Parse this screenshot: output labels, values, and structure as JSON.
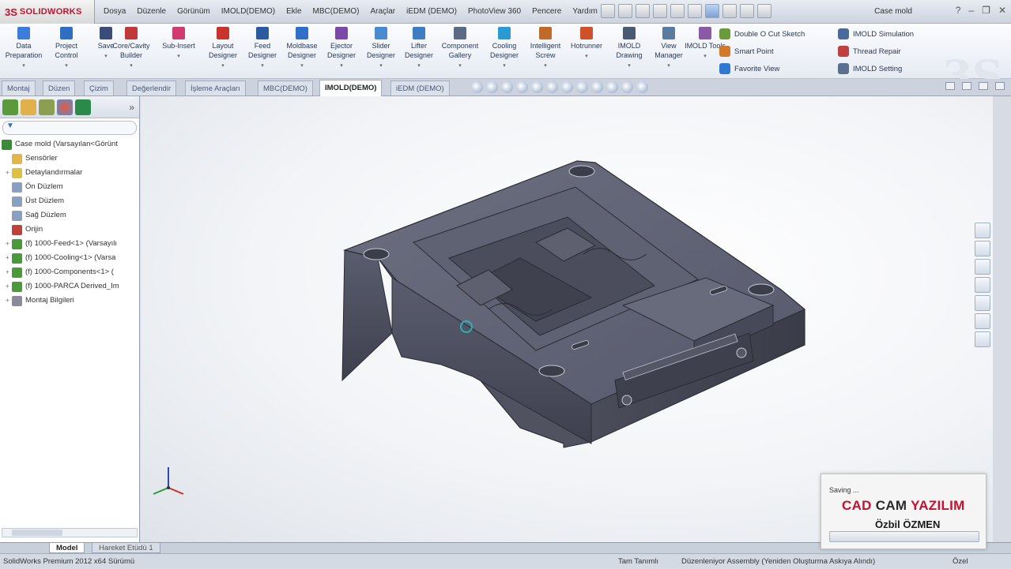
{
  "app": {
    "brand_mark": "3S",
    "brand_name": "SOLIDWORKS",
    "doc_title": "Case mold"
  },
  "menu": [
    "Dosya",
    "Düzenle",
    "Görünüm",
    "IMOLD(DEMO)",
    "Ekle",
    "MBC(DEMO)",
    "Araçlar",
    "iEDM (DEMO)",
    "PhotoView 360",
    "Pencere",
    "Yardım"
  ],
  "ribbon": {
    "buttons": [
      {
        "label": "Data Preparation",
        "icon": "data-preparation-icon",
        "color": "#3b7dd8"
      },
      {
        "label": "Project Control",
        "icon": "project-control-icon",
        "color": "#2f6fc2"
      },
      {
        "label": "Save",
        "icon": "save-icon",
        "color": "#3a4c7a"
      },
      {
        "label": "Core/Cavity Builder",
        "icon": "core-cavity-icon",
        "color": "#c03a3a"
      },
      {
        "label": "Sub-Insert",
        "icon": "sub-insert-icon",
        "color": "#d03a6e"
      },
      {
        "label": "Layout Designer",
        "icon": "layout-designer-icon",
        "color": "#c8342b"
      },
      {
        "label": "Feed Designer",
        "icon": "feed-designer-icon",
        "color": "#2c5aa0"
      },
      {
        "label": "Moldbase Designer",
        "icon": "moldbase-designer-icon",
        "color": "#2f6ec9"
      },
      {
        "label": "Ejector Designer",
        "icon": "ejector-designer-icon",
        "color": "#7a4aa8"
      },
      {
        "label": "Slider Designer",
        "icon": "slider-designer-icon",
        "color": "#4a8ad0"
      },
      {
        "label": "Lifter Designer",
        "icon": "lifter-designer-icon",
        "color": "#3e7cc4"
      },
      {
        "label": "Component Gallery",
        "icon": "component-gallery-icon",
        "color": "#5a6c84"
      },
      {
        "label": "Cooling Designer",
        "icon": "cooling-designer-icon",
        "color": "#2a9ad4"
      },
      {
        "label": "Intelligent Screw",
        "icon": "intelligent-screw-icon",
        "color": "#c06a2a"
      },
      {
        "label": "Hotrunner",
        "icon": "hotrunner-icon",
        "color": "#d0502a"
      },
      {
        "label": "IMOLD Drawing",
        "icon": "imold-drawing-icon",
        "color": "#4a5a70"
      },
      {
        "label": "View Manager",
        "icon": "view-manager-icon",
        "color": "#5a7aa0"
      },
      {
        "label": "IMOLD Tools",
        "icon": "imold-tools-icon",
        "color": "#8a5aa8"
      }
    ],
    "side1": [
      {
        "label": "Double O Cut Sketch",
        "icon": "double-o-cut-sketch-icon",
        "color": "#6a9a3a"
      },
      {
        "label": "Smart Point",
        "icon": "smart-point-icon",
        "color": "#d07a2a"
      },
      {
        "label": "Favorite View",
        "icon": "favorite-view-icon",
        "color": "#2f7ad0"
      }
    ],
    "side2": [
      {
        "label": "IMOLD Simulation",
        "icon": "imold-simulation-icon",
        "color": "#4a6a9a"
      },
      {
        "label": "Thread Repair",
        "icon": "thread-repair-icon",
        "color": "#c04040"
      },
      {
        "label": "IMOLD Setting",
        "icon": "imold-setting-icon",
        "color": "#5a7090"
      }
    ]
  },
  "tabs": [
    "Montaj",
    "Düzen",
    "Çizim",
    "Değerlendir",
    "İşleme Araçları",
    "MBC(DEMO)",
    "IMOLD(DEMO)",
    "iEDM (DEMO)"
  ],
  "active_tab": "IMOLD(DEMO)",
  "tree": [
    {
      "label": "Case mold  (Varsayılan<Görünt",
      "icon": "assembly-icon",
      "color": "#3a8a3a",
      "expand": ""
    },
    {
      "label": "Sensörler",
      "icon": "sensors-folder-icon",
      "color": "#e2b64a",
      "expand": ""
    },
    {
      "label": "Detaylandırmalar",
      "icon": "annotations-icon",
      "color": "#e0c040",
      "expand": "+"
    },
    {
      "label": "Ön Düzlem",
      "icon": "plane-icon",
      "color": "#8aa0c0",
      "expand": ""
    },
    {
      "label": "Üst Düzlem",
      "icon": "plane-icon",
      "color": "#8aa0c0",
      "expand": ""
    },
    {
      "label": "Sağ Düzlem",
      "icon": "plane-icon",
      "color": "#8aa0c0",
      "expand": ""
    },
    {
      "label": "Orijin",
      "icon": "origin-icon",
      "color": "#c0403a",
      "expand": ""
    },
    {
      "label": "(f) 1000-Feed<1> (Varsayılı",
      "icon": "part-icon",
      "color": "#4a9a3a",
      "expand": "+"
    },
    {
      "label": "(f) 1000-Cooling<1> (Varsa",
      "icon": "part-icon",
      "color": "#4a9a3a",
      "expand": "+"
    },
    {
      "label": "(f) 1000-Components<1> (",
      "icon": "part-icon",
      "color": "#4a9a3a",
      "expand": "+"
    },
    {
      "label": "(f) 1000-PARCA Derived_Im",
      "icon": "part-icon",
      "color": "#4a9a3a",
      "expand": "+"
    },
    {
      "label": "Montaj Bilgileri",
      "icon": "mates-icon",
      "color": "#8a8a9a",
      "expand": "+"
    }
  ],
  "bottom_tabs": [
    "Model",
    "Hareket Etüdü 1"
  ],
  "status": {
    "version": "SolidWorks Premium 2012 x64 Sürümü",
    "definition": "Tam Tanımlı",
    "editing": "Düzenleniyor Assembly (Yeniden Oluşturma Askıya Alındı)",
    "custom": "Özel"
  },
  "overlay": {
    "saving": "Saving ...",
    "brand_part1": "CAD",
    "brand_part2": "CAM",
    "brand_part3": "YAZILIM",
    "person": "Özbil ÖZMEN",
    "progress": 0.0
  }
}
